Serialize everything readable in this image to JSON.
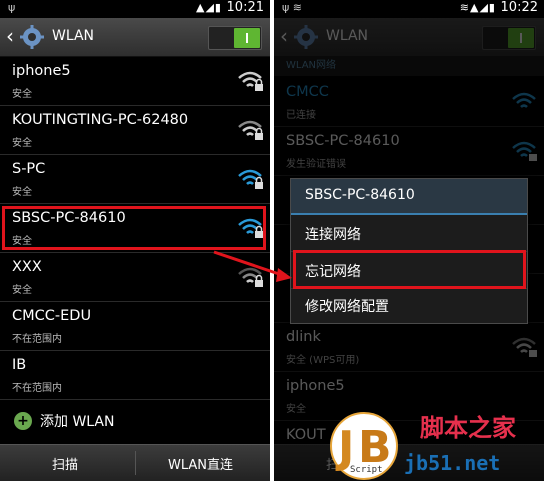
{
  "left": {
    "statusbar": {
      "time": "10:21"
    },
    "actionbar": {
      "title": "WLAN"
    },
    "networks": [
      {
        "name": "iphone5",
        "status": "安全"
      },
      {
        "name": "KOUTINGTING-PC-62480",
        "status": "安全"
      },
      {
        "name": "S-PC",
        "status": "安全"
      },
      {
        "name": "SBSC-PC-84610",
        "status": "安全"
      },
      {
        "name": "XXX",
        "status": "安全"
      },
      {
        "name": "CMCC-EDU",
        "status": "不在范围内"
      },
      {
        "name": "IB",
        "status": "不在范围内"
      }
    ],
    "add_label": "添加 WLAN",
    "bottom": {
      "scan": "扫描",
      "direct": "WLAN直连"
    }
  },
  "right": {
    "statusbar": {
      "time": "10:22"
    },
    "actionbar": {
      "title": "WLAN"
    },
    "section_label": "WLAN网络",
    "networks": [
      {
        "name": "CMCC",
        "status": "已连接"
      },
      {
        "name": "SBSC-PC-84610",
        "status": "发生验证错误"
      },
      {
        "name": "",
        "status": ""
      },
      {
        "name": "",
        "status": ""
      },
      {
        "name": "",
        "status": ""
      },
      {
        "name": "dlink",
        "status": "安全 (WPS可用)"
      },
      {
        "name": "iphone5",
        "status": "安全"
      },
      {
        "name": "KOUT",
        "status": ""
      }
    ],
    "bottom": {
      "scan": "扫"
    },
    "context_menu": {
      "title": "SBSC-PC-84610",
      "items": [
        "连接网络",
        "忘记网络",
        "修改网络配置"
      ]
    }
  },
  "watermark": {
    "brand_cn": "脚本之家",
    "site": "jb51.net",
    "script_label": "Script"
  },
  "colors": {
    "highlight": "#e0141c",
    "toggle_on": "#5fb632",
    "wifi_connected": "#2a9ad8"
  }
}
